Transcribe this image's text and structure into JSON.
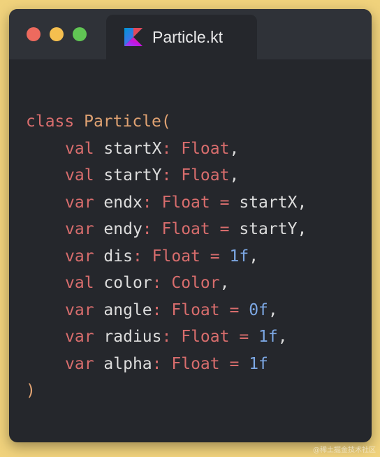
{
  "window": {
    "tab_title": "Particle.kt",
    "tab_icon": "kotlin-icon",
    "traffic_lights": [
      {
        "name": "close",
        "color": "#ed6a5e"
      },
      {
        "name": "minimize",
        "color": "#f5bf4f"
      },
      {
        "name": "zoom",
        "color": "#61c554"
      }
    ]
  },
  "colors": {
    "background": "#f0d27c",
    "editor": "#25272c",
    "keyword": "#d86d6d",
    "class_name": "#e0a272",
    "number": "#7ca7e3",
    "text": "#dcdcdc"
  },
  "code": {
    "header": {
      "kw": "class",
      "name": "Particle",
      "open": "("
    },
    "params": [
      {
        "kw": "val",
        "name": "startX",
        "colon": ":",
        "type": "Float",
        "default_op": "",
        "default": "",
        "default_kind": "",
        "trail": ","
      },
      {
        "kw": "val",
        "name": "startY",
        "colon": ":",
        "type": "Float",
        "default_op": "",
        "default": "",
        "default_kind": "",
        "trail": ","
      },
      {
        "kw": "var",
        "name": "endx",
        "colon": ":",
        "type": "Float",
        "default_op": "=",
        "default": "startX",
        "default_kind": "id",
        "trail": ","
      },
      {
        "kw": "var",
        "name": "endy",
        "colon": ":",
        "type": "Float",
        "default_op": "=",
        "default": "startY",
        "default_kind": "id",
        "trail": ","
      },
      {
        "kw": "var",
        "name": "dis",
        "colon": ":",
        "type": "Float",
        "default_op": "=",
        "default": "1f",
        "default_kind": "num",
        "trail": ","
      },
      {
        "kw": "val",
        "name": "color",
        "colon": ":",
        "type": "Color",
        "default_op": "",
        "default": "",
        "default_kind": "",
        "trail": ","
      },
      {
        "kw": "var",
        "name": "angle",
        "colon": ":",
        "type": "Float",
        "default_op": "=",
        "default": "0f",
        "default_kind": "num",
        "trail": ","
      },
      {
        "kw": "var",
        "name": "radius",
        "colon": ":",
        "type": "Float",
        "default_op": "=",
        "default": "1f",
        "default_kind": "num",
        "trail": ","
      },
      {
        "kw": "var",
        "name": "alpha",
        "colon": ":",
        "type": "Float",
        "default_op": "=",
        "default": "1f",
        "default_kind": "num",
        "trail": ""
      }
    ],
    "footer": ")"
  },
  "watermark": "@稀土掘金技术社区"
}
